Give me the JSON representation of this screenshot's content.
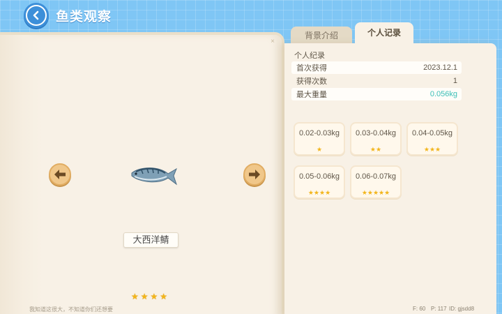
{
  "header": {
    "title": "鱼类观察"
  },
  "book": {
    "fish_name": "大西洋鲭",
    "rarity_stars": [
      "★",
      "★",
      "★",
      "★"
    ],
    "bottom_note": "我知道这很大，不知道你们还想要",
    "corner_mark": "×"
  },
  "tabs": [
    {
      "label": "背景介绍",
      "selected": false
    },
    {
      "label": "个人记录",
      "selected": true
    }
  ],
  "record": {
    "title": "个人纪录",
    "rows": [
      {
        "label": "首次获得",
        "value": "2023.12.1"
      },
      {
        "label": "获得次数",
        "value": "1"
      },
      {
        "label": "最大重量",
        "value": "0.056kg"
      }
    ]
  },
  "weight_cards": [
    {
      "range": "0.02-0.03kg",
      "stars": "★"
    },
    {
      "range": "0.03-0.04kg",
      "stars": "★★"
    },
    {
      "range": "0.04-0.05kg",
      "stars": "★★★"
    },
    {
      "range": "0.05-0.06kg",
      "stars": "★★★★"
    },
    {
      "range": "0.06-0.07kg",
      "stars": "★★★★★"
    }
  ],
  "footer": {
    "fps": "F: 60",
    "ping": "P: 117",
    "id": "ID: gjsdd8"
  },
  "colors": {
    "background": "#7fc6f5",
    "paper": "#f8f1e6",
    "accent": "#3bbfb7",
    "star": "#f2b51b",
    "arrow": "#f0c78a"
  }
}
